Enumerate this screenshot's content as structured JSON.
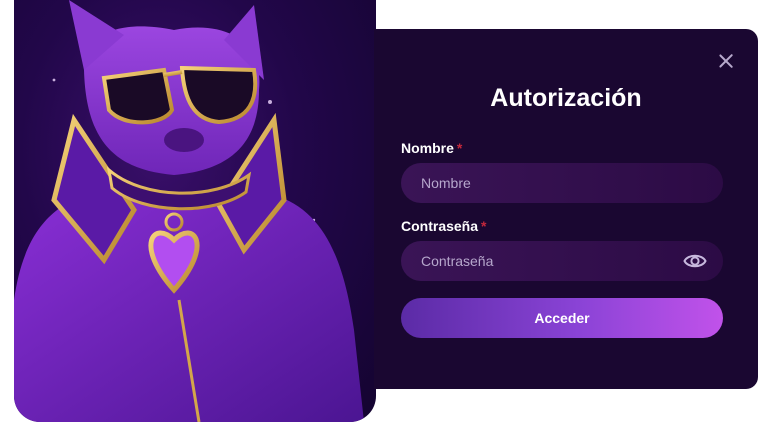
{
  "modal": {
    "title": "Autorización",
    "close_icon": "close-icon",
    "name_field": {
      "label": "Nombre",
      "required_mark": "*",
      "placeholder": "Nombre",
      "value": ""
    },
    "password_field": {
      "label": "Contraseña",
      "required_mark": "*",
      "placeholder": "Contraseña",
      "value": "",
      "toggle_icon": "eye-icon"
    },
    "submit_label": "Acceder"
  },
  "colors": {
    "modal_bg": "#1a0731",
    "field_bg": "#3a1456",
    "required": "#c4283c",
    "button_start": "#5b2ba6",
    "button_end": "#c152ea"
  }
}
